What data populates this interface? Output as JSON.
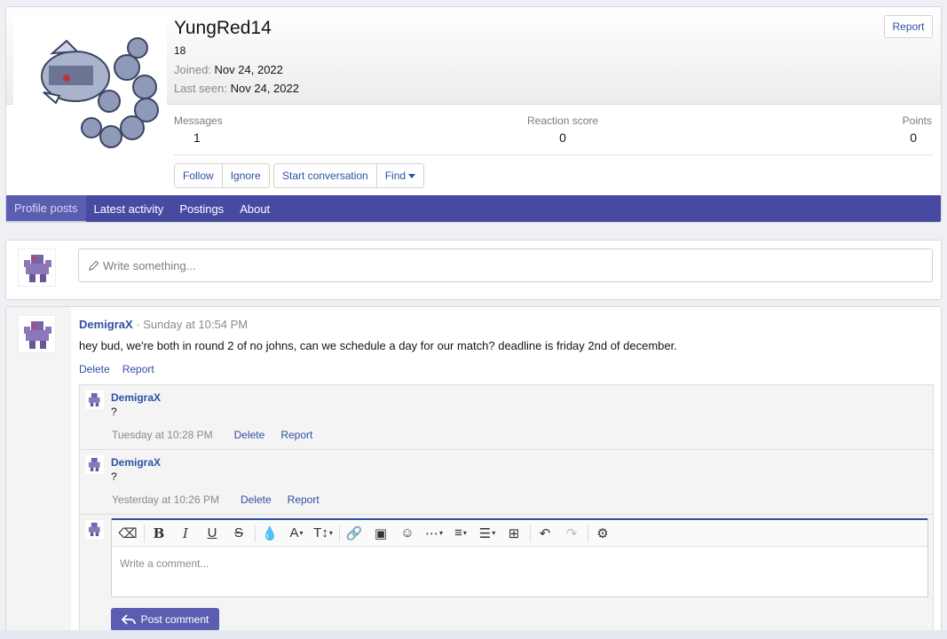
{
  "profile": {
    "username": "YungRed14",
    "custom_title": "18",
    "joined_label": "Joined:",
    "joined_value": "Nov 24, 2022",
    "last_seen_label": "Last seen:",
    "last_seen_value": "Nov 24, 2022",
    "report_label": "Report",
    "stats": {
      "messages_label": "Messages",
      "messages_value": "1",
      "reaction_label": "Reaction score",
      "reaction_value": "0",
      "points_label": "Points",
      "points_value": "0"
    },
    "buttons": {
      "follow": "Follow",
      "ignore": "Ignore",
      "start_conversation": "Start conversation",
      "find": "Find"
    }
  },
  "tabs": [
    {
      "label": "Profile posts",
      "active": true
    },
    {
      "label": "Latest activity",
      "active": false
    },
    {
      "label": "Postings",
      "active": false
    },
    {
      "label": "About",
      "active": false
    }
  ],
  "new_post": {
    "placeholder": "Write something..."
  },
  "message": {
    "user": "DemigraX",
    "separator": " · ",
    "time": "Sunday at 10:54 PM",
    "body": "hey bud, we're both in round 2 of no johns, can we schedule a day for our match? deadline is friday 2nd of december.",
    "delete_label": "Delete",
    "report_label": "Report"
  },
  "comments": [
    {
      "user": "DemigraX",
      "text": "?",
      "time": "Tuesday at 10:28 PM",
      "delete_label": "Delete",
      "report_label": "Report"
    },
    {
      "user": "DemigraX",
      "text": "?",
      "time": "Yesterday at 10:26 PM",
      "delete_label": "Delete",
      "report_label": "Report"
    }
  ],
  "reply": {
    "placeholder": "Write a comment...",
    "post_button": "Post comment",
    "toolbar_icons": [
      "eraser-icon",
      "bold-icon",
      "italic-icon",
      "underline-icon",
      "strikethrough-icon",
      "text-color-icon",
      "font-family-icon",
      "font-size-icon",
      "link-icon",
      "image-icon",
      "smilie-icon",
      "more-icon",
      "align-icon",
      "list-icon",
      "table-icon",
      "undo-icon",
      "redo-icon",
      "settings-icon"
    ]
  },
  "colors": {
    "accent": "#474aa0",
    "link": "#2f4fa3",
    "button": "#5b5eb0"
  }
}
